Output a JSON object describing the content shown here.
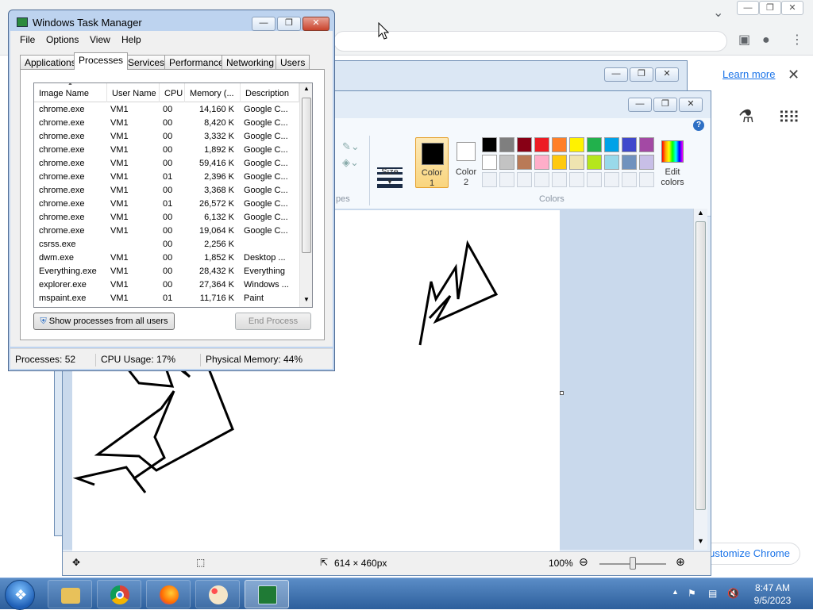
{
  "chrome": {
    "learn_more": "Learn more",
    "customize": "Customize Chrome",
    "customize_visible": "ustomize Chrome"
  },
  "paint": {
    "size_label": "Size",
    "color1_label": "Color\n1",
    "color2_label": "Color\n2",
    "edit_colors_label": "Edit\ncolors",
    "colors_group": "Colors",
    "shapes_group_partial": "pes",
    "canvas_size": "614 × 460px",
    "zoom": "100%",
    "palette_row1": [
      "#000000",
      "#7f7f7f",
      "#880015",
      "#ed1c24",
      "#ff7f27",
      "#fff200",
      "#22b14c",
      "#00a2e8",
      "#3f48cc",
      "#a349a4"
    ],
    "palette_row2": [
      "#ffffff",
      "#c3c3c3",
      "#b97a57",
      "#ffaec9",
      "#ffc90e",
      "#efe4b0",
      "#b5e61d",
      "#99d9ea",
      "#7092be",
      "#c8bfe7"
    ]
  },
  "taskmgr": {
    "title": "Windows Task Manager",
    "menu": [
      "File",
      "Options",
      "View",
      "Help"
    ],
    "tabs": [
      "Applications",
      "Processes",
      "Services",
      "Performance",
      "Networking",
      "Users"
    ],
    "columns": [
      "Image Name",
      "User Name",
      "CPU",
      "Memory (...",
      "Description"
    ],
    "rows": [
      {
        "name": "chrome.exe",
        "user": "VM1",
        "cpu": "00",
        "mem": "14,160 K",
        "desc": "Google C..."
      },
      {
        "name": "chrome.exe",
        "user": "VM1",
        "cpu": "00",
        "mem": "8,420 K",
        "desc": "Google C..."
      },
      {
        "name": "chrome.exe",
        "user": "VM1",
        "cpu": "00",
        "mem": "3,332 K",
        "desc": "Google C..."
      },
      {
        "name": "chrome.exe",
        "user": "VM1",
        "cpu": "00",
        "mem": "1,892 K",
        "desc": "Google C..."
      },
      {
        "name": "chrome.exe",
        "user": "VM1",
        "cpu": "00",
        "mem": "59,416 K",
        "desc": "Google C..."
      },
      {
        "name": "chrome.exe",
        "user": "VM1",
        "cpu": "01",
        "mem": "2,396 K",
        "desc": "Google C..."
      },
      {
        "name": "chrome.exe",
        "user": "VM1",
        "cpu": "00",
        "mem": "3,368 K",
        "desc": "Google C..."
      },
      {
        "name": "chrome.exe",
        "user": "VM1",
        "cpu": "01",
        "mem": "26,572 K",
        "desc": "Google C..."
      },
      {
        "name": "chrome.exe",
        "user": "VM1",
        "cpu": "00",
        "mem": "6,132 K",
        "desc": "Google C..."
      },
      {
        "name": "chrome.exe",
        "user": "VM1",
        "cpu": "00",
        "mem": "19,064 K",
        "desc": "Google C..."
      },
      {
        "name": "csrss.exe",
        "user": "",
        "cpu": "00",
        "mem": "2,256 K",
        "desc": ""
      },
      {
        "name": "dwm.exe",
        "user": "VM1",
        "cpu": "00",
        "mem": "1,852 K",
        "desc": "Desktop ..."
      },
      {
        "name": "Everything.exe",
        "user": "VM1",
        "cpu": "00",
        "mem": "28,432 K",
        "desc": "Everything"
      },
      {
        "name": "explorer.exe",
        "user": "VM1",
        "cpu": "00",
        "mem": "27,364 K",
        "desc": "Windows ..."
      },
      {
        "name": "mspaint.exe",
        "user": "VM1",
        "cpu": "01",
        "mem": "11,716 K",
        "desc": "Paint"
      }
    ],
    "show_all_button": "Show processes from all users",
    "end_process_button": "End Process",
    "status": {
      "processes": "Processes: 52",
      "cpu": "CPU Usage: 17%",
      "memory": "Physical Memory: 44%"
    }
  },
  "taskbar": {
    "time": "8:47 AM",
    "date": "9/5/2023"
  }
}
